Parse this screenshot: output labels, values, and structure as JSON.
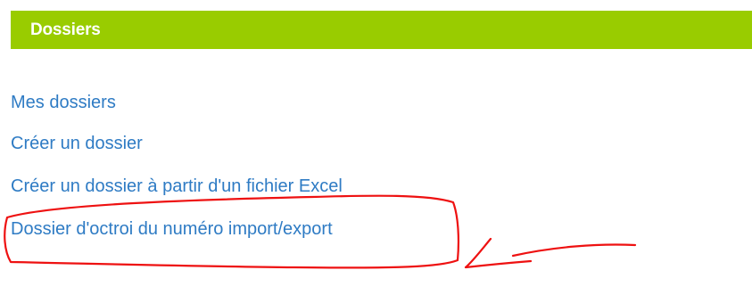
{
  "section": {
    "title": "Dossiers"
  },
  "links": [
    {
      "label": "Mes dossiers"
    },
    {
      "label": "Créer un dossier"
    },
    {
      "label": "Créer un dossier à partir d'un fichier Excel"
    },
    {
      "label": "Dossier d'octroi du numéro import/export"
    }
  ],
  "annotation": {
    "color": "#ee1111",
    "shapes": [
      "highlight-circle",
      "pointer-arrow"
    ]
  },
  "colors": {
    "header_bg": "#99cc00",
    "header_text": "#ffffff",
    "link": "#2e7bc4"
  }
}
